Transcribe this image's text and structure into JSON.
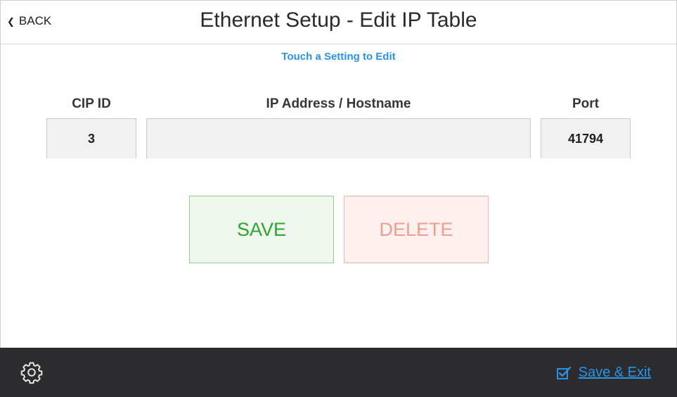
{
  "header": {
    "back_label": "BACK",
    "title": "Ethernet Setup - Edit IP Table"
  },
  "hint": "Touch a Setting to Edit",
  "table": {
    "columns": [
      "CIP ID",
      "IP Address / Hostname",
      "Port"
    ],
    "values": {
      "cip_id": "3",
      "ip_address": "",
      "port": "41794"
    }
  },
  "actions": {
    "save_label": "SAVE",
    "delete_label": "DELETE"
  },
  "footer": {
    "save_exit_label": "Save & Exit"
  },
  "colors": {
    "accent": "#2a93e6",
    "save": "#2ea52e",
    "delete": "#f29c8d",
    "footer_bg": "#2c2c2e"
  },
  "icons": [
    "chevron-left-icon",
    "gear-icon",
    "checkbox-check-icon"
  ]
}
